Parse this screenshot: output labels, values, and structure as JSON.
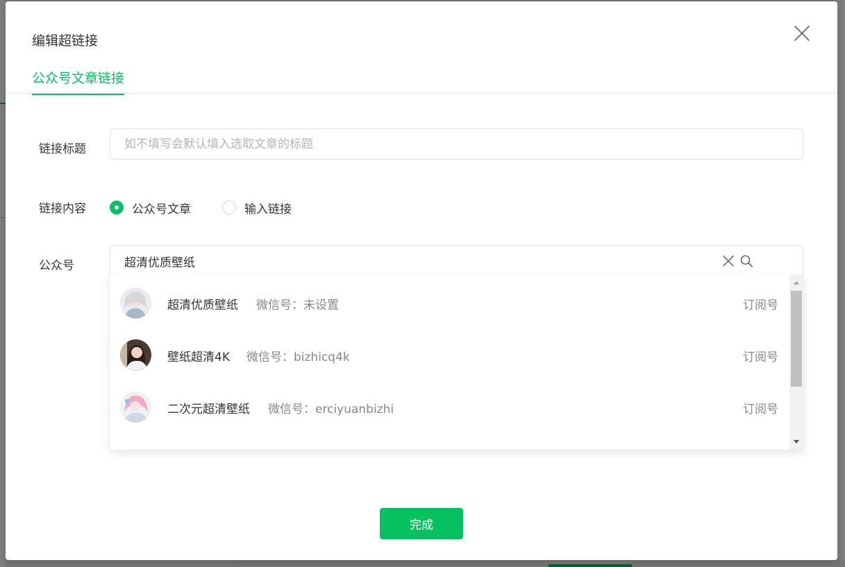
{
  "dialog": {
    "title": "编辑超链接",
    "tab_label": "公众号文章链接"
  },
  "form": {
    "title_label": "链接标题",
    "title_placeholder": "如不填写会默认填入选取文章的标题",
    "content_label": "链接内容",
    "radio_options": [
      {
        "label": "公众号文章",
        "checked": true
      },
      {
        "label": "输入链接",
        "checked": false
      }
    ],
    "account_label": "公众号",
    "search_value": "超清优质壁纸"
  },
  "results": [
    {
      "name": "超清优质壁纸",
      "wechat_id": "微信号：未设置",
      "type": "订阅号"
    },
    {
      "name": "壁纸超清4K",
      "wechat_id": "微信号：bizhicq4k",
      "type": "订阅号"
    },
    {
      "name": "二次元超清壁纸",
      "wechat_id": "微信号：erciyuanbizhi",
      "type": "订阅号"
    }
  ],
  "footer": {
    "done_label": "完成"
  },
  "colors": {
    "accent": "#07c160",
    "text": "#353535",
    "secondary_text": "#888888"
  },
  "icons": [
    "close-icon",
    "clear-icon",
    "search-icon",
    "radio-checked-icon",
    "radio-unchecked-icon"
  ]
}
